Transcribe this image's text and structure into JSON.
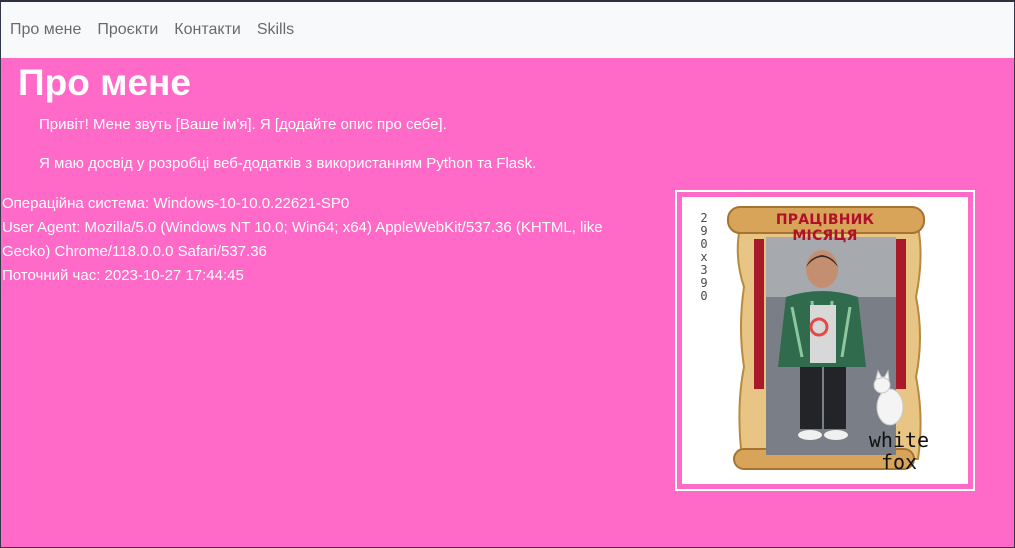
{
  "nav": {
    "items": [
      {
        "label": "Про мене"
      },
      {
        "label": "Проєкти"
      },
      {
        "label": "Контакти"
      },
      {
        "label": "Skills"
      }
    ]
  },
  "main": {
    "title": "Про мене",
    "paragraphs": [
      "Привіт! Мене звуть [Ваше ім'я]. Я [додайте опис про себе].",
      "Я маю досвід у розробці веб-додатків з використанням Python та Flask."
    ]
  },
  "system": {
    "os": "Операційна система: Windows-10-10.0.22621-SP0",
    "user_agent": "User Agent: Mozilla/5.0 (Windows NT 10.0; Win64; x64) AppleWebKit/537.36 (KHTML, like Gecko) Chrome/118.0.0.0 Safari/537.36",
    "time": "Поточний час: 2023-10-27 17:44:45"
  },
  "photo": {
    "dimensions": "2\n9\n0\nx\n3\n9\n0",
    "banner": "ПРАЦІВНИК МІСЯЦЯ",
    "brand": "white\nfox"
  },
  "colors": {
    "page_background": "#ff69c7",
    "navbar_background": "#f8f9fa",
    "banner_text": "#b0102a"
  }
}
